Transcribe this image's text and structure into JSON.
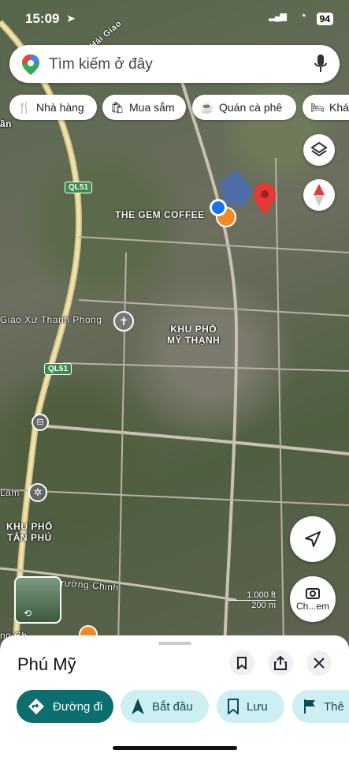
{
  "status": {
    "time": "15:09",
    "battery": "94"
  },
  "search": {
    "placeholder": "Tìm kiếm ở đây"
  },
  "chips": [
    {
      "label": "Nhà hàng",
      "icon": "fork-knife-icon"
    },
    {
      "label": "Mua sắm",
      "icon": "shopping-bag-icon"
    },
    {
      "label": "Quán cà phê",
      "icon": "coffee-cup-icon"
    },
    {
      "label": "Khá",
      "icon": "bed-icon"
    }
  ],
  "map": {
    "labels": {
      "coffee": "THE GEM COFFEE",
      "parish": "Giáo Xứ Thanh Phong",
      "district1_line1": "KHU PHỐ",
      "district1_line2": "MỸ THẠNH",
      "district2_line1": "KHU PHỐ",
      "district2_line2": "TÂN PHÚ",
      "road_top": "Hải Giao",
      "road_bottom": "Trường Chinh",
      "lam": "Lâm",
      "an": "ần",
      "ngc": "ng Ch",
      "highway1": "QL51",
      "highway2": "QL51"
    },
    "scale": {
      "ft": "1.000 ft",
      "m": "200 m"
    },
    "colors": {
      "pin": "#e53935",
      "location": "#1a73e8",
      "accent": "#0b6e6f"
    }
  },
  "buttons": {
    "chat_label": "Ch...em"
  },
  "sheet": {
    "title": "Phú Mỹ",
    "actions": [
      {
        "label": "Đường đi",
        "icon": "directions-icon"
      },
      {
        "label": "Bắt đầu",
        "icon": "navigation-arrow-icon"
      },
      {
        "label": "Lưu",
        "icon": "bookmark-icon"
      },
      {
        "label": "Thê",
        "icon": "flag-icon"
      }
    ]
  }
}
